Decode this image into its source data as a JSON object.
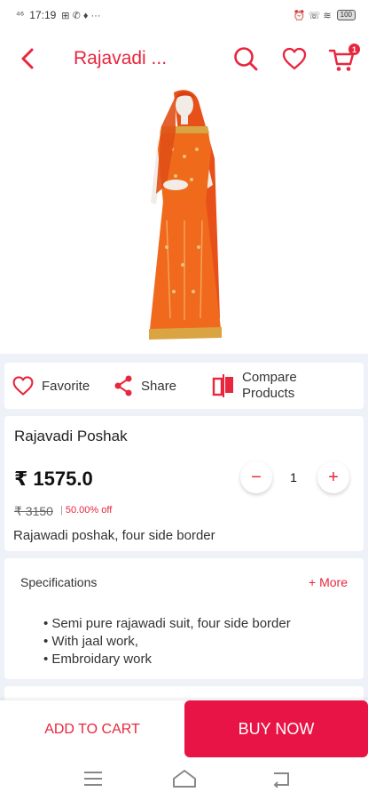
{
  "status_bar": {
    "time": "17:19",
    "left_icons": "⊞ ✆ ♦ ···",
    "right_icons": "⏰ ☏ ≋",
    "battery": "100"
  },
  "header": {
    "title": "Rajavadi ...",
    "back_icon": "chevron-left-icon",
    "search_icon": "search-icon",
    "favorite_icon": "heart-icon",
    "cart_icon": "cart-icon",
    "cart_badge": "1"
  },
  "product_image": {
    "alt": "Rajavadi Poshak"
  },
  "actions": {
    "favorite": "Favorite",
    "share": "Share",
    "compare": "Compare Products"
  },
  "product": {
    "name": "Rajavadi Poshak",
    "price": "₹ 1575.0",
    "original_price": "₹ 3150",
    "discount": "50.00% off",
    "discount_separator": "|",
    "short_description": "Rajawadi poshak, four side border",
    "quantity": "1",
    "qty_minus": "−",
    "qty_plus": "+"
  },
  "specifications": {
    "title": "Specifications",
    "more": "+ More",
    "items": [
      "Semi pure rajawadi suit, four side border",
      "With jaal work,",
      "Embroidary work"
    ]
  },
  "bottom": {
    "add_to_cart": "ADD TO CART",
    "buy_now": "BUY NOW"
  },
  "colors": {
    "accent": "#e8263d",
    "buy_now_bg": "#e81445",
    "page_bg": "#eef1f7"
  }
}
